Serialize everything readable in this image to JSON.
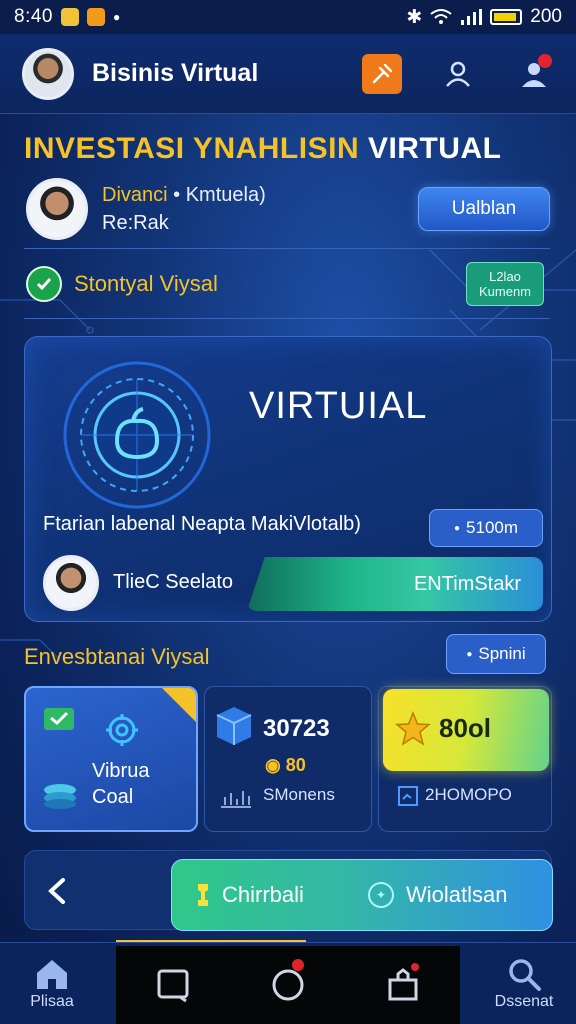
{
  "statusbar": {
    "time": "8:40",
    "battery_text": "200"
  },
  "appbar": {
    "title": "Bisinis Virtual"
  },
  "header": {
    "headline_gold": "INVESTASI YNAHLISIN",
    "headline_white": "VIRTUAL",
    "profile_name_gold": "Divanci",
    "profile_name_rest": " • Kmtuela)",
    "profile_sub": "Re:Rak",
    "profile_button": "Ualblan",
    "status_text": "Stontyal Viysal",
    "status_tag_line1": "L2lao",
    "status_tag_line2": "Kumenm"
  },
  "feature": {
    "title": "VIRTUIAL",
    "description": "Ftarian labenal Neapta MakiVlotalb)",
    "amount": "5100m",
    "name": "TlieC Seelato",
    "action_label": "ENTimStakr"
  },
  "section": {
    "title": "Envesbtanai Viysal",
    "pill_label": "Spnini"
  },
  "stats": {
    "card1_line1": "Vibrua",
    "card1_line2": "Coal",
    "card2_value": "30723",
    "card2_coins": "80",
    "card2_sub": "SMonens",
    "card3_value": "80ol",
    "card3_sub": "2HOMOPO"
  },
  "actions": {
    "left_label": "Chirrbali",
    "right_label": "Wiolatlsan"
  },
  "nav": {
    "home_label": "Plisaa",
    "search_label": "Dssenat"
  },
  "colors": {
    "accent_gold": "#f5c227",
    "primary_blue": "#2a5fc9",
    "success_green": "#1aa34a",
    "background": "#123578"
  }
}
